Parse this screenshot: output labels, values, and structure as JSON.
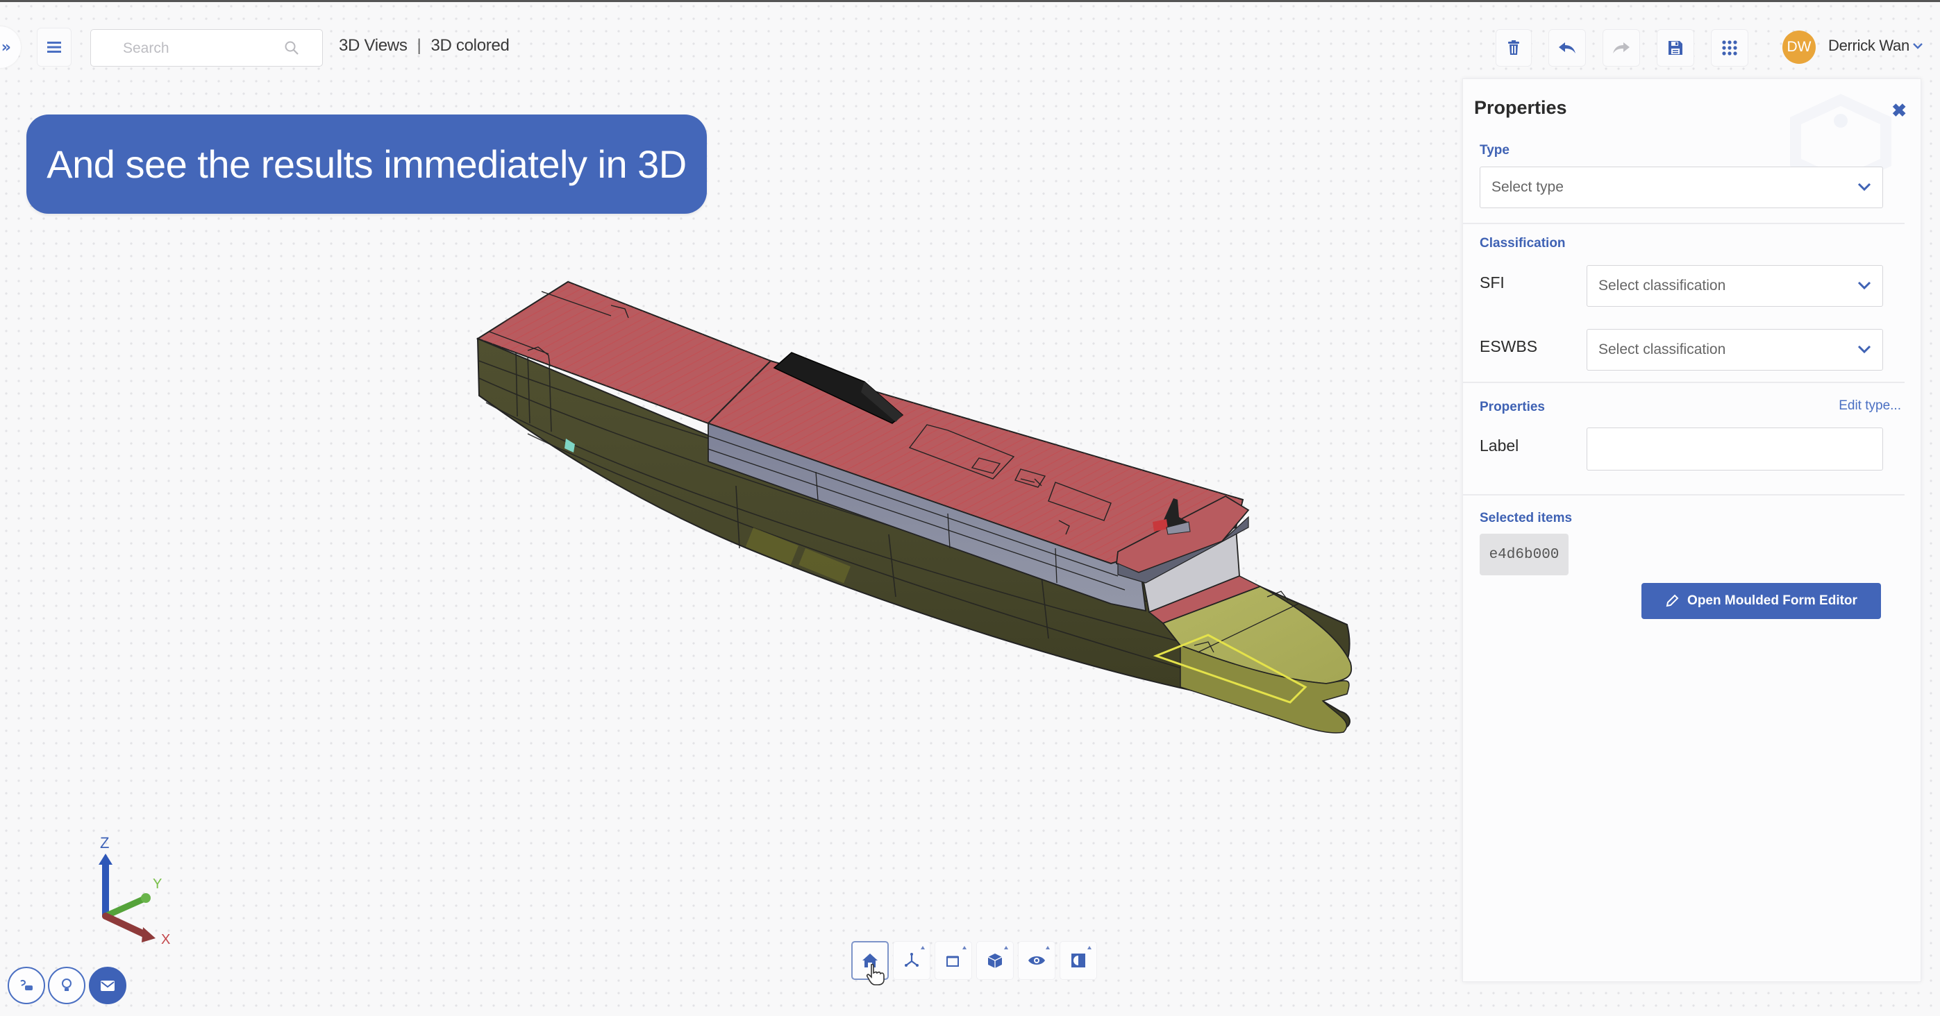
{
  "topbar": {
    "expand_icon": "double-chevron-right-icon",
    "menu_icon": "hamburger-menu-icon",
    "search": {
      "placeholder": "Search",
      "value": "",
      "icon": "search-icon"
    },
    "breadcrumb": {
      "parent": "3D Views",
      "separator": "|",
      "current": "3D colored"
    },
    "actions": [
      {
        "name": "delete",
        "icon": "trash-icon",
        "enabled": true
      },
      {
        "name": "undo",
        "icon": "undo-icon",
        "enabled": true
      },
      {
        "name": "redo",
        "icon": "redo-icon",
        "enabled": false
      },
      {
        "name": "save",
        "icon": "floppy-disk-icon",
        "enabled": true
      },
      {
        "name": "apps",
        "icon": "grid-icon",
        "enabled": true
      }
    ],
    "user": {
      "initials": "DW",
      "name": "Derrick Wan",
      "avatar_color": "#e9a53a"
    }
  },
  "banner": {
    "text": "And see the results immediately in 3D",
    "color": "#4467b9"
  },
  "viewport": {
    "model": "ship-hull-3d-model",
    "colors": {
      "deck": "#b85b5f",
      "hull": "#4a4a2e",
      "bow": "#b7b862",
      "superstructure": "#8a8ea2",
      "funnel": "#1a1a1a",
      "selection_outline": "#e4e24a"
    },
    "axis_labels": {
      "x": "X",
      "y": "Y",
      "z": "Z"
    },
    "view_toolbar": [
      {
        "name": "home",
        "icon": "home-icon",
        "active": true,
        "has_menu": false
      },
      {
        "name": "axes",
        "icon": "axes-icon",
        "active": false,
        "has_menu": true
      },
      {
        "name": "section",
        "icon": "section-box-icon",
        "active": false,
        "has_menu": true
      },
      {
        "name": "cube",
        "icon": "cube-icon",
        "active": false,
        "has_menu": true
      },
      {
        "name": "visibility",
        "icon": "eye-icon",
        "active": false,
        "has_menu": true
      },
      {
        "name": "render-mode",
        "icon": "contrast-icon",
        "active": false,
        "has_menu": true
      }
    ],
    "bottom_left_buttons": [
      {
        "name": "chat",
        "icon": "chat-icon",
        "filled": false
      },
      {
        "name": "tips",
        "icon": "lightbulb-icon",
        "filled": false
      },
      {
        "name": "message",
        "icon": "mail-icon",
        "filled": true
      }
    ]
  },
  "properties_panel": {
    "title": "Properties",
    "close_icon": "close-icon",
    "type": {
      "label": "Type",
      "placeholder": "Select type"
    },
    "classification": {
      "label": "Classification",
      "fields": [
        {
          "label": "SFI",
          "placeholder": "Select classification"
        },
        {
          "label": "ESWBS",
          "placeholder": "Select classification"
        }
      ]
    },
    "properties": {
      "label": "Properties",
      "edit_link": "Edit type...",
      "fields": [
        {
          "label": "Label",
          "value": ""
        }
      ]
    },
    "selected_items": {
      "label": "Selected items",
      "items": [
        "e4d6b000"
      ]
    },
    "primary_action": {
      "label": "Open Moulded Form Editor",
      "icon": "pencil-icon"
    },
    "accent_color": "#3f62b4"
  }
}
